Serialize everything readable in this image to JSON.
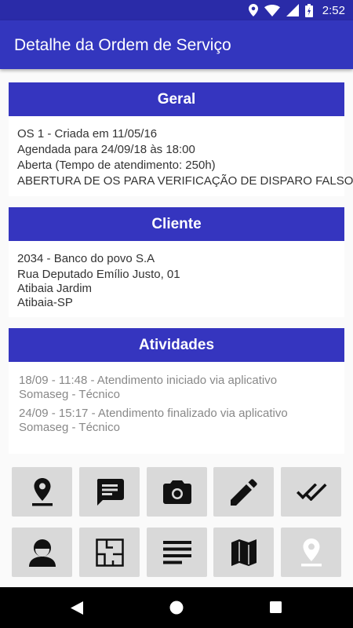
{
  "status_bar": {
    "time": "2:52"
  },
  "app_bar": {
    "title": "Detalhe da Ordem de Serviço"
  },
  "sections": {
    "geral": {
      "title": "Geral",
      "lines": [
        "OS 1 - Criada em 11/05/16",
        "Agendada para 24/09/18 às 18:00",
        "Aberta (Tempo de atendimento: 250h)",
        "ABERTURA DE OS PARA VERIFICAÇÃO DE DISPARO FALSO"
      ]
    },
    "cliente": {
      "title": "Cliente",
      "lines": [
        "2034 - Banco do povo S.A",
        "Rua Deputado Emílio Justo, 01",
        "Atibaia Jardim",
        "Atibaia-SP"
      ]
    },
    "atividades": {
      "title": "Atividades",
      "items": [
        {
          "line1": "18/09 - 11:48 - Atendimento iniciado via aplicativo",
          "line2": "Somaseg - Técnico"
        },
        {
          "line1": "24/09 - 15:17 - Atendimento finalizado via aplicativo",
          "line2": "Somaseg - Técnico"
        }
      ]
    }
  },
  "action_buttons": {
    "row1": [
      "location-pin-icon",
      "message-icon",
      "camera-icon",
      "edit-pencil-icon",
      "double-check-icon"
    ],
    "row2": [
      "person-icon",
      "floor-plan-icon",
      "notes-lines-icon",
      "map-icon",
      "location-pin-disabled-icon"
    ]
  },
  "colors": {
    "status_bar": "#2a2ba8",
    "app_bar": "#3336be",
    "section_header": "#3535bf",
    "button_bg": "#d9d9d9",
    "icon": "#111111",
    "icon_disabled": "#ffffff"
  }
}
